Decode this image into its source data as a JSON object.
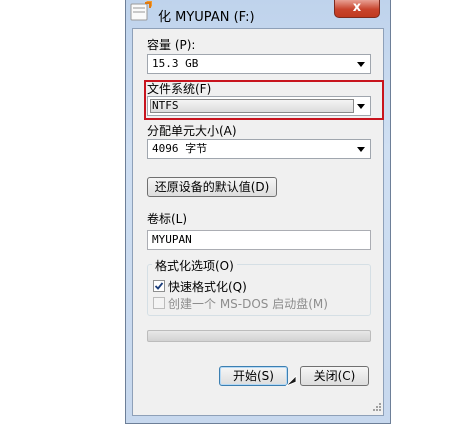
{
  "window": {
    "title": "化 MYUPAN (F:)",
    "close_label": "x"
  },
  "capacity": {
    "label": "容量 (P):",
    "value": "15.3 GB"
  },
  "file_system": {
    "label": "文件系统(F)",
    "value": "NTFS"
  },
  "allocation": {
    "label": "分配单元大小(A)",
    "value": "4096 字节"
  },
  "restore_button": "还原设备的默认值(D)",
  "volume": {
    "label": "卷标(L)",
    "value": "MYUPAN"
  },
  "options": {
    "title": "格式化选项(O)",
    "quick_format": {
      "label": "快速格式化(Q)",
      "checked": true
    },
    "msdos_disk": {
      "label": "创建一个 MS-DOS 启动盘(M)",
      "checked": false,
      "disabled": true
    }
  },
  "progress": {
    "value": 0
  },
  "buttons": {
    "start": "开始(S)",
    "close": "关闭(C)"
  },
  "colors": {
    "highlight": "#c8141e",
    "close_button": "#c8442d",
    "title_bar": "#bfd3ec"
  }
}
